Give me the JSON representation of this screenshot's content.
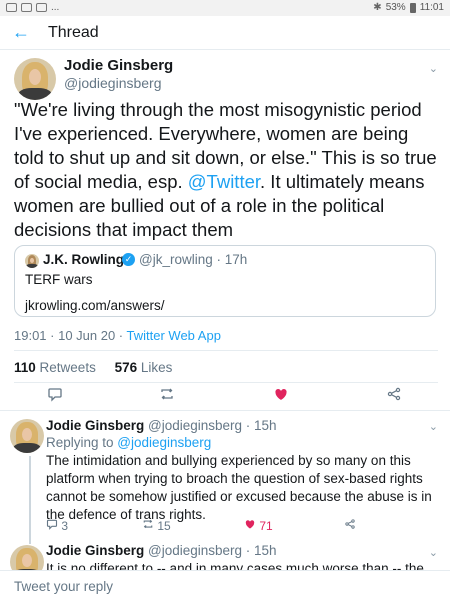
{
  "status_bar": {
    "battery": "53%",
    "time": "11:01",
    "dots": "..."
  },
  "header": {
    "title": "Thread"
  },
  "main_tweet": {
    "name": "Jodie Ginsberg",
    "handle": "@jodieginsberg",
    "text_before_link": "\"We're living through the most misogynistic period I've experienced. Everywhere, women are being told to shut up and sit down, or else.\" This is so true of social media, esp. ",
    "link": "@Twitter",
    "text_after_link": ". It ultimately means women are bullied out of a role in the political decisions that impact them",
    "quote": {
      "name": "J.K. Rowling",
      "handle": "@jk_rowling · 17h",
      "text": "TERF wars",
      "link": "jkrowling.com/answers/"
    },
    "time": "19:01 · 10 Jun 20 · ",
    "source": "Twitter Web App",
    "retweets": "110",
    "retweets_label": "Retweets",
    "likes": "576",
    "likes_label": "Likes"
  },
  "replies": [
    {
      "name": "Jodie Ginsberg",
      "meta": " @jodieginsberg · 15h",
      "replying_prefix": "Replying to ",
      "replying_link": "@jodieginsberg",
      "text": "The intimidation and bullying experienced by so many on this platform when trying to broach the question of sex-based rights cannot be somehow justified or excused because the abuse is in the defence of trans rights.",
      "reply_count": "3",
      "retweet_count": "15",
      "like_count": "71"
    },
    {
      "name": "Jodie Ginsberg",
      "meta": " @jodieginsberg · 15h",
      "text": "It is no different to -- and in many cases much worse than -- the vile"
    }
  ],
  "compose": {
    "placeholder": "Tweet your reply"
  },
  "icons": {
    "back": "back-arrow-icon",
    "reply": "reply-icon",
    "retweet": "retweet-icon",
    "like": "heart-icon",
    "share": "share-icon"
  },
  "colors": {
    "accent": "#1da1f2",
    "like": "#e0245e",
    "muted": "#657786"
  }
}
